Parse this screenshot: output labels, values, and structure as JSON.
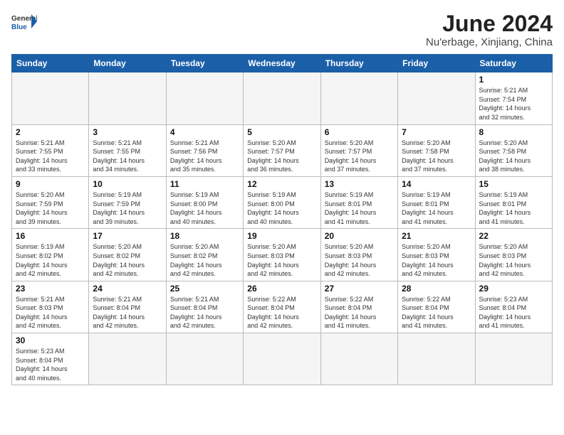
{
  "header": {
    "logo_general": "General",
    "logo_blue": "Blue",
    "title": "June 2024",
    "location": "Nu'erbage, Xinjiang, China"
  },
  "weekdays": [
    "Sunday",
    "Monday",
    "Tuesday",
    "Wednesday",
    "Thursday",
    "Friday",
    "Saturday"
  ],
  "weeks": [
    {
      "days": [
        {
          "num": "",
          "info": ""
        },
        {
          "num": "",
          "info": ""
        },
        {
          "num": "",
          "info": ""
        },
        {
          "num": "",
          "info": ""
        },
        {
          "num": "",
          "info": ""
        },
        {
          "num": "",
          "info": ""
        },
        {
          "num": "1",
          "info": "Sunrise: 5:21 AM\nSunset: 7:54 PM\nDaylight: 14 hours\nand 32 minutes."
        }
      ]
    },
    {
      "days": [
        {
          "num": "2",
          "info": "Sunrise: 5:21 AM\nSunset: 7:55 PM\nDaylight: 14 hours\nand 33 minutes."
        },
        {
          "num": "3",
          "info": "Sunrise: 5:21 AM\nSunset: 7:55 PM\nDaylight: 14 hours\nand 34 minutes."
        },
        {
          "num": "4",
          "info": "Sunrise: 5:21 AM\nSunset: 7:56 PM\nDaylight: 14 hours\nand 35 minutes."
        },
        {
          "num": "5",
          "info": "Sunrise: 5:20 AM\nSunset: 7:57 PM\nDaylight: 14 hours\nand 36 minutes."
        },
        {
          "num": "6",
          "info": "Sunrise: 5:20 AM\nSunset: 7:57 PM\nDaylight: 14 hours\nand 37 minutes."
        },
        {
          "num": "7",
          "info": "Sunrise: 5:20 AM\nSunset: 7:58 PM\nDaylight: 14 hours\nand 37 minutes."
        },
        {
          "num": "8",
          "info": "Sunrise: 5:20 AM\nSunset: 7:58 PM\nDaylight: 14 hours\nand 38 minutes."
        }
      ]
    },
    {
      "days": [
        {
          "num": "9",
          "info": "Sunrise: 5:20 AM\nSunset: 7:59 PM\nDaylight: 14 hours\nand 39 minutes."
        },
        {
          "num": "10",
          "info": "Sunrise: 5:19 AM\nSunset: 7:59 PM\nDaylight: 14 hours\nand 39 minutes."
        },
        {
          "num": "11",
          "info": "Sunrise: 5:19 AM\nSunset: 8:00 PM\nDaylight: 14 hours\nand 40 minutes."
        },
        {
          "num": "12",
          "info": "Sunrise: 5:19 AM\nSunset: 8:00 PM\nDaylight: 14 hours\nand 40 minutes."
        },
        {
          "num": "13",
          "info": "Sunrise: 5:19 AM\nSunset: 8:01 PM\nDaylight: 14 hours\nand 41 minutes."
        },
        {
          "num": "14",
          "info": "Sunrise: 5:19 AM\nSunset: 8:01 PM\nDaylight: 14 hours\nand 41 minutes."
        },
        {
          "num": "15",
          "info": "Sunrise: 5:19 AM\nSunset: 8:01 PM\nDaylight: 14 hours\nand 41 minutes."
        }
      ]
    },
    {
      "days": [
        {
          "num": "16",
          "info": "Sunrise: 5:19 AM\nSunset: 8:02 PM\nDaylight: 14 hours\nand 42 minutes."
        },
        {
          "num": "17",
          "info": "Sunrise: 5:20 AM\nSunset: 8:02 PM\nDaylight: 14 hours\nand 42 minutes."
        },
        {
          "num": "18",
          "info": "Sunrise: 5:20 AM\nSunset: 8:02 PM\nDaylight: 14 hours\nand 42 minutes."
        },
        {
          "num": "19",
          "info": "Sunrise: 5:20 AM\nSunset: 8:03 PM\nDaylight: 14 hours\nand 42 minutes."
        },
        {
          "num": "20",
          "info": "Sunrise: 5:20 AM\nSunset: 8:03 PM\nDaylight: 14 hours\nand 42 minutes."
        },
        {
          "num": "21",
          "info": "Sunrise: 5:20 AM\nSunset: 8:03 PM\nDaylight: 14 hours\nand 42 minutes."
        },
        {
          "num": "22",
          "info": "Sunrise: 5:20 AM\nSunset: 8:03 PM\nDaylight: 14 hours\nand 42 minutes."
        }
      ]
    },
    {
      "days": [
        {
          "num": "23",
          "info": "Sunrise: 5:21 AM\nSunset: 8:03 PM\nDaylight: 14 hours\nand 42 minutes."
        },
        {
          "num": "24",
          "info": "Sunrise: 5:21 AM\nSunset: 8:04 PM\nDaylight: 14 hours\nand 42 minutes."
        },
        {
          "num": "25",
          "info": "Sunrise: 5:21 AM\nSunset: 8:04 PM\nDaylight: 14 hours\nand 42 minutes."
        },
        {
          "num": "26",
          "info": "Sunrise: 5:22 AM\nSunset: 8:04 PM\nDaylight: 14 hours\nand 42 minutes."
        },
        {
          "num": "27",
          "info": "Sunrise: 5:22 AM\nSunset: 8:04 PM\nDaylight: 14 hours\nand 41 minutes."
        },
        {
          "num": "28",
          "info": "Sunrise: 5:22 AM\nSunset: 8:04 PM\nDaylight: 14 hours\nand 41 minutes."
        },
        {
          "num": "29",
          "info": "Sunrise: 5:23 AM\nSunset: 8:04 PM\nDaylight: 14 hours\nand 41 minutes."
        }
      ]
    },
    {
      "days": [
        {
          "num": "30",
          "info": "Sunrise: 5:23 AM\nSunset: 8:04 PM\nDaylight: 14 hours\nand 40 minutes."
        },
        {
          "num": "",
          "info": ""
        },
        {
          "num": "",
          "info": ""
        },
        {
          "num": "",
          "info": ""
        },
        {
          "num": "",
          "info": ""
        },
        {
          "num": "",
          "info": ""
        },
        {
          "num": "",
          "info": ""
        }
      ]
    }
  ]
}
